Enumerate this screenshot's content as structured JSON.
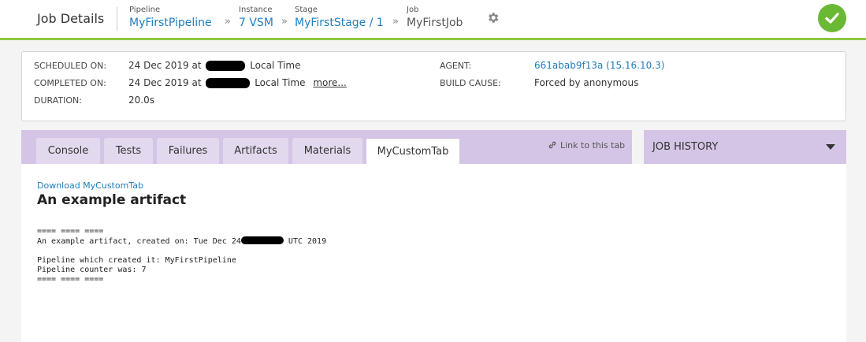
{
  "header": {
    "title": "Job Details",
    "breadcrumb": [
      {
        "label": "Pipeline",
        "value": "MyFirstPipeline"
      },
      {
        "label": "Instance",
        "value": "7 VSM"
      },
      {
        "label": "Stage",
        "value": "MyFirstStage / 1"
      },
      {
        "label": "Job",
        "value": "MyFirstJob"
      }
    ],
    "separator": "»",
    "settings_icon": "gear-icon",
    "status_icon": "check-circle-icon",
    "status_color": "#6ab934"
  },
  "info": {
    "scheduled_label": "SCHEDULED ON:",
    "scheduled_value_prefix": "24 Dec 2019 at",
    "scheduled_value_suffix": "Local Time",
    "completed_label": "COMPLETED ON:",
    "completed_value_prefix": "24 Dec 2019 at",
    "completed_value_suffix": "Local Time",
    "more_link": "more...",
    "duration_label": "DURATION:",
    "duration_value": "20.0s",
    "agent_label": "AGENT:",
    "agent_value": "661abab9f13a (15.16.10.3)",
    "build_cause_label": "BUILD CAUSE:",
    "build_cause_value": "Forced by anonymous"
  },
  "tabs": [
    {
      "label": "Console"
    },
    {
      "label": "Tests"
    },
    {
      "label": "Failures"
    },
    {
      "label": "Artifacts"
    },
    {
      "label": "Materials"
    },
    {
      "label": "MyCustomTab"
    }
  ],
  "active_tab": "MyCustomTab",
  "link_to_tab": "Link to this tab",
  "job_history": {
    "title": "JOB HISTORY"
  },
  "content": {
    "download_link": "Download MyCustomTab",
    "artifact_title": "An example artifact",
    "line1": "==== ==== ====",
    "line2_prefix": "An example artifact, created on: Tue Dec 24",
    "line2_suffix": "UTC 2019",
    "line4": "Pipeline which created it: MyFirstPipeline",
    "line5": "Pipeline counter was: 7",
    "line6": "==== ==== ===="
  },
  "colors": {
    "accent_green": "#8dc63f",
    "link_blue": "#1e7ebd",
    "tab_bar_purple": "#d4c5e6"
  }
}
